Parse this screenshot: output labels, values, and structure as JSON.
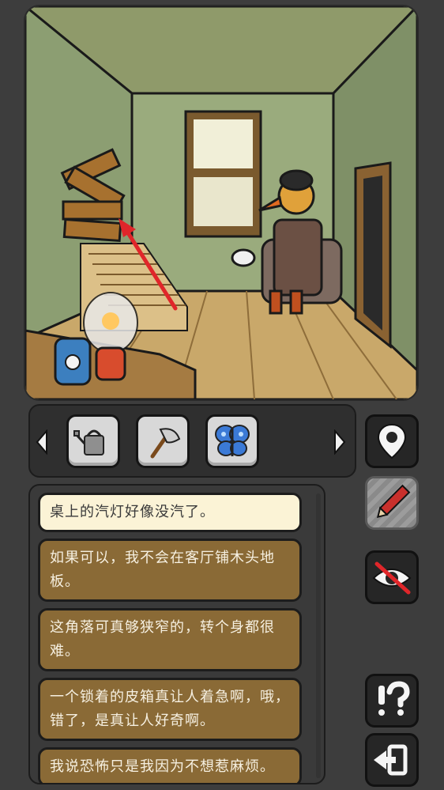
{
  "inventory": {
    "prev_icon": "chevron-left-icon",
    "next_icon": "chevron-right-icon",
    "items": [
      {
        "name": "watering-can",
        "icon": "watering-can-icon"
      },
      {
        "name": "axe",
        "icon": "axe-icon"
      },
      {
        "name": "butterfly",
        "icon": "butterfly-icon"
      }
    ]
  },
  "side_buttons": [
    {
      "name": "map-button",
      "icon": "location-pin-icon"
    },
    {
      "name": "notes-button",
      "icon": "pencil-icon"
    },
    {
      "name": "hide-button",
      "icon": "crossed-eye-icon"
    },
    {
      "name": "hint-button",
      "icon": "exclamation-question-icon"
    },
    {
      "name": "exit-button",
      "icon": "exit-arrow-icon"
    }
  ],
  "dialog": {
    "lines": [
      "桌上的汽灯好像没汽了。",
      "如果可以，我不会在客厅铺木头地板。",
      "这角落可真够狭窄的，转个身都很难。",
      "一个锁着的皮箱真让人着急啊，哦，错了，是真让人好奇啊。",
      "我说恐怖只是我因为不想惹麻烦。"
    ]
  },
  "colors": {
    "background": "#3d3d3d",
    "dialog_line": "#8a6a36",
    "dialog_current": "#fbf3d6",
    "hint_arrow": "#e0262a"
  }
}
